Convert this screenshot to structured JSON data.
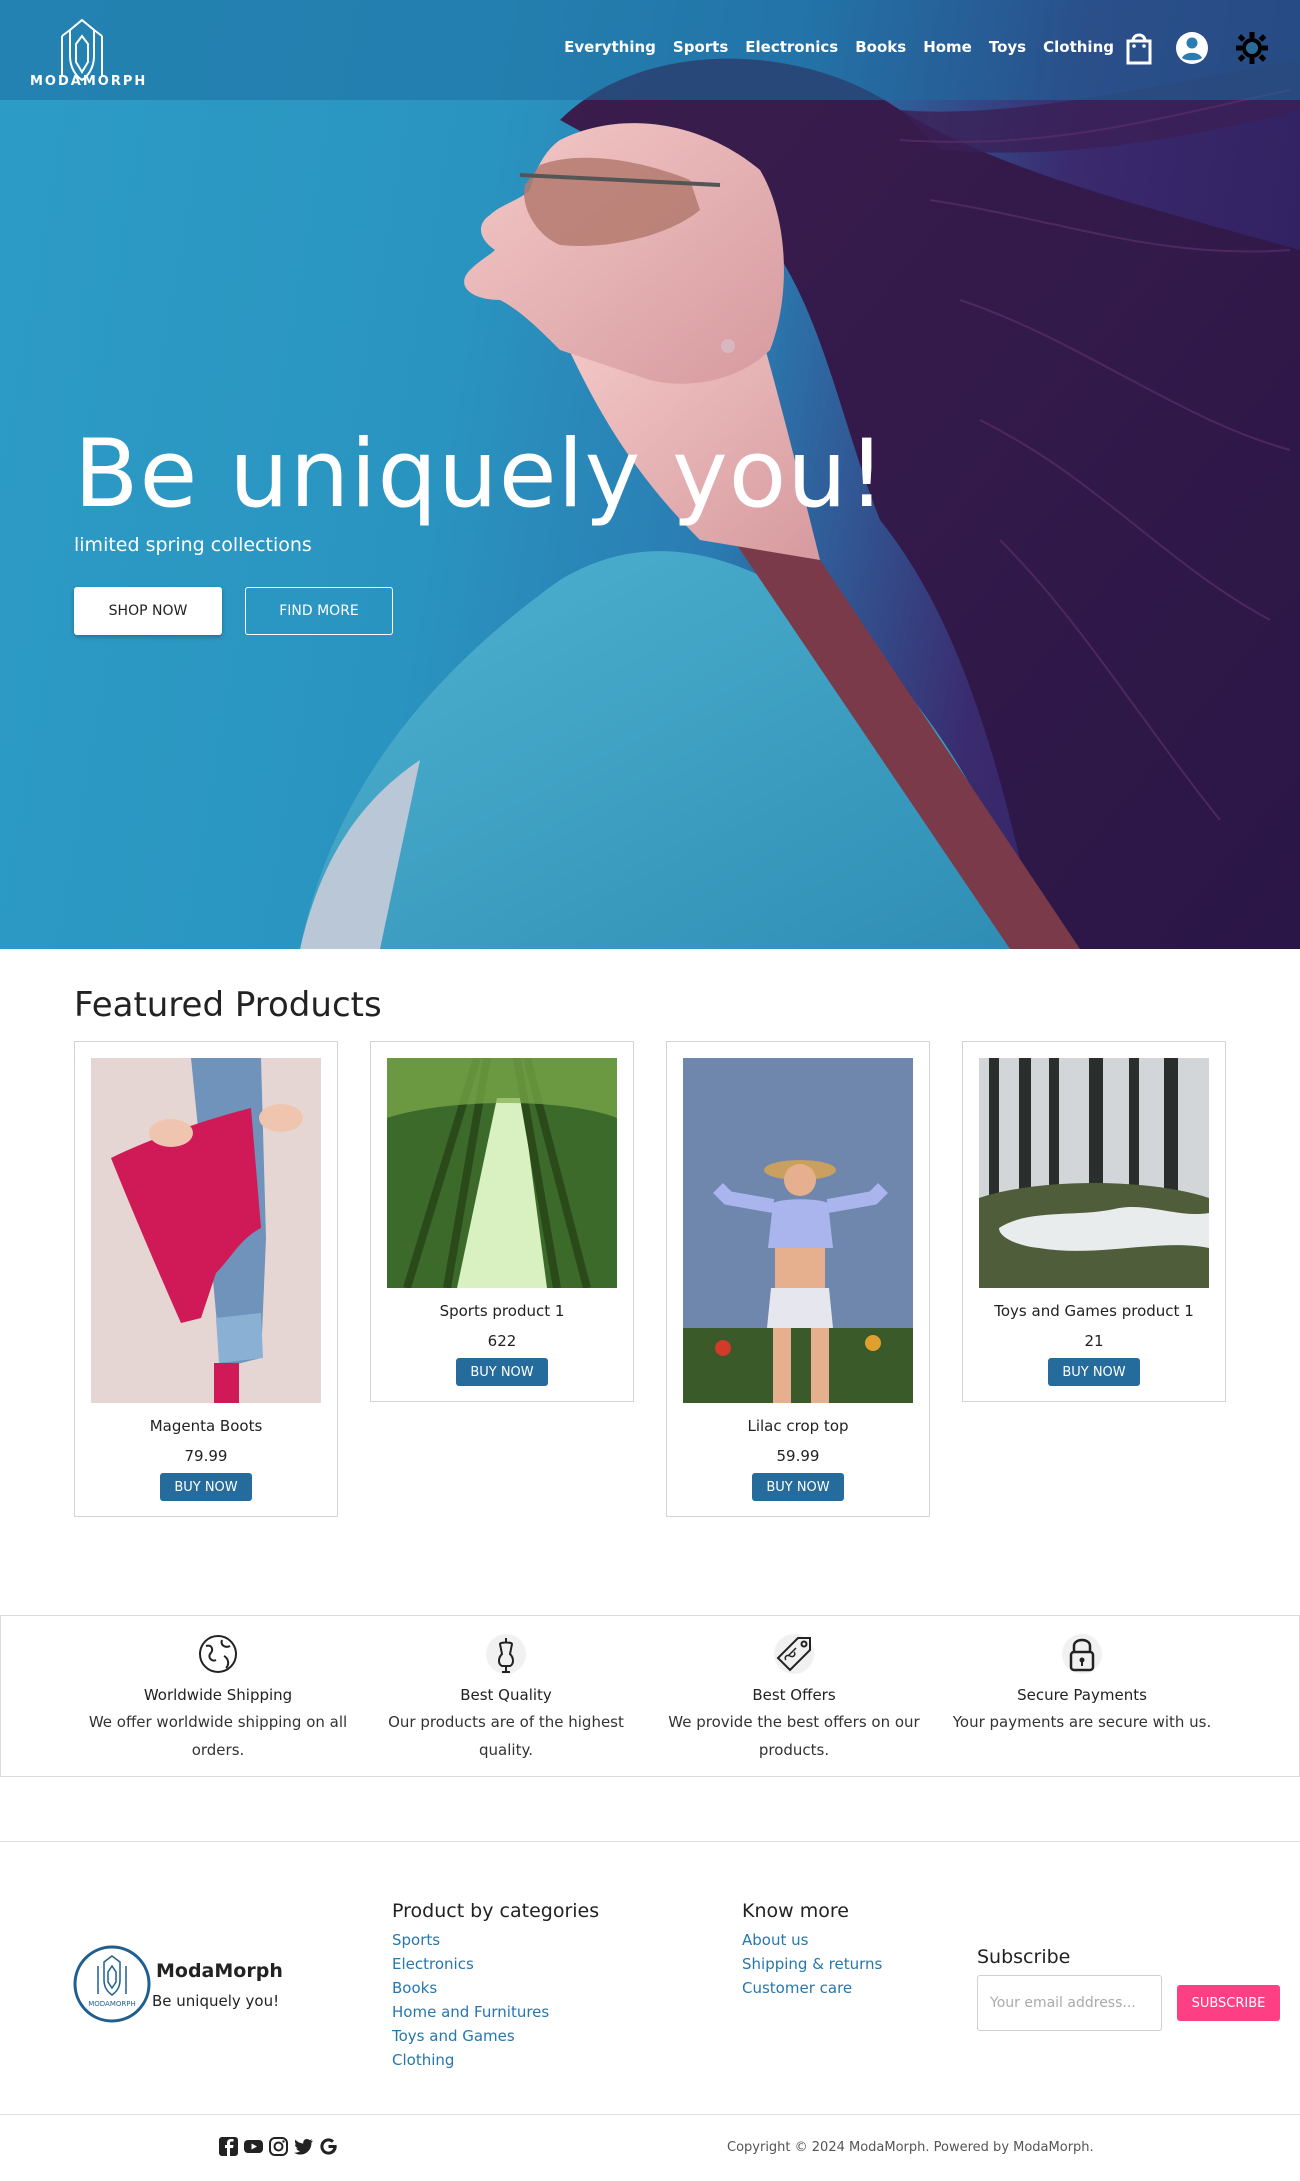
{
  "brand": {
    "logo_word": "MODAMORPH",
    "name": "ModaMorph",
    "tagline": "Be uniquely you!"
  },
  "nav": {
    "items": [
      "Everything",
      "Sports",
      "Electronics",
      "Books",
      "Home",
      "Toys",
      "Clothing"
    ],
    "icons": [
      "shopping-bag-icon",
      "user-account-icon",
      "theme-toggle-icon"
    ]
  },
  "hero": {
    "title": "Be uniquely you!",
    "subtitle": "limited spring collections",
    "shop_now": "SHOP NOW",
    "find_more": "FIND MORE"
  },
  "featured": {
    "title": "Featured Products",
    "products": [
      {
        "name": "Magenta Boots",
        "price": "79.99",
        "buy": "BUY NOW"
      },
      {
        "name": "Sports product 1",
        "price": "622",
        "buy": "BUY NOW"
      },
      {
        "name": "Lilac crop top",
        "price": "59.99",
        "buy": "BUY NOW"
      },
      {
        "name": "Toys and Games product 1",
        "price": "21",
        "buy": "BUY NOW"
      }
    ]
  },
  "features": [
    {
      "icon": "globe-icon",
      "title": "Worldwide Shipping",
      "desc": "We offer worldwide shipping on all orders."
    },
    {
      "icon": "mannequin-icon",
      "title": "Best Quality",
      "desc": "Our products are of the highest quality."
    },
    {
      "icon": "price-tag-icon",
      "title": "Best Offers",
      "desc": "We provide the best offers on our products."
    },
    {
      "icon": "padlock-icon",
      "title": "Secure Payments",
      "desc": "Your payments are secure with us."
    }
  ],
  "footer": {
    "categories_title": "Product by categories",
    "categories": [
      "Sports",
      "Electronics",
      "Books",
      "Home and Furnitures",
      "Toys and Games",
      "Clothing"
    ],
    "know_title": "Know more",
    "know": [
      "About us",
      "Shipping & returns",
      "Customer care"
    ],
    "subscribe_title": "Subscribe",
    "email_placeholder": "Your email address...",
    "subscribe_button": "SUBSCRIBE",
    "social_icons": [
      "facebook-icon",
      "youtube-icon",
      "instagram-icon",
      "twitter-icon",
      "google-icon"
    ],
    "copyright": "Copyright © 2024 ModaMorph. Powered by ModaMorph."
  },
  "colors": {
    "accent": "#256c9c",
    "link": "#2577b0",
    "subscribe": "#ff3f84",
    "hero_blue": "#2c9cc6",
    "hero_purple": "#2e1e5c"
  }
}
